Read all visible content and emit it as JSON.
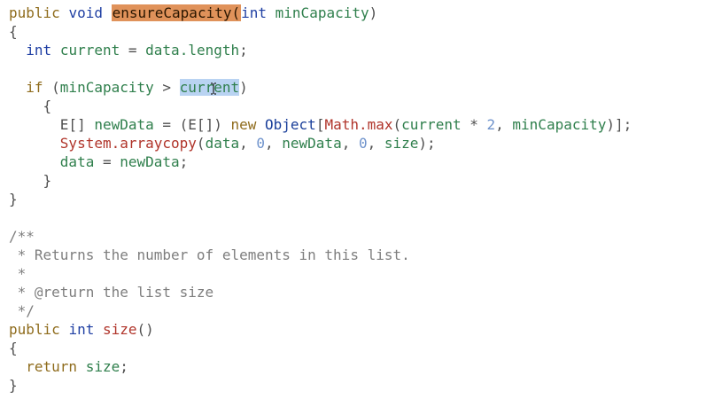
{
  "code": {
    "l1": {
      "k1": "public",
      "k2": "void",
      "method": "ensureCapacity",
      "p_open": "(",
      "t": "int",
      "param": "minCapacity",
      "p_close": ")"
    },
    "l2": {
      "brace": "{"
    },
    "l3": {
      "t": "int",
      "var": "current",
      "eq": " = ",
      "rhs": "data.length",
      "semi": ";"
    },
    "l4": {
      "kw": "if",
      "op1": " (",
      "v1": "minCapacity",
      "op2": " > ",
      "v2": "current",
      "op3": ")"
    },
    "l5": {
      "brace": "{"
    },
    "l6": {
      "a": "E[] ",
      "b": "newData",
      "c": " = (E[]) ",
      "d": "new",
      "e": " ",
      "f": "Object",
      "g": "[",
      "h": "Math.max",
      "i": "(",
      "j": "current",
      "k": " * ",
      "l": "2",
      "m": ", ",
      "n": "minCapacity",
      "o": ")];"
    },
    "l7": {
      "a": "System.arraycopy",
      "b": "(",
      "c": "data",
      "d": ", ",
      "e": "0",
      "f": ", ",
      "g": "newData",
      "h": ", ",
      "i": "0",
      "j": ", ",
      "k": "size",
      "l": ");"
    },
    "l8": {
      "a": "data",
      "b": " = ",
      "c": "newData",
      "d": ";"
    },
    "l9": {
      "brace": "}"
    },
    "l10": {
      "brace": "}"
    },
    "l11": {
      "text": "/**"
    },
    "l12": {
      "text": " * Returns the number of elements in this list."
    },
    "l13": {
      "text": " *"
    },
    "l14": {
      "text": " * @return the list size"
    },
    "l15": {
      "text": " */"
    },
    "l16": {
      "k1": "public",
      "t": "int",
      "m": "size",
      "p": "()"
    },
    "l17": {
      "brace": "{"
    },
    "l18": {
      "kw": "return",
      "v": "size",
      "semi": ";"
    },
    "l19": {
      "brace": "}"
    }
  },
  "icons": {
    "cursor": "text-cursor-icon"
  },
  "colors": {
    "method_highlight": "#e0925a",
    "variable_highlight": "#b9d3f2"
  }
}
